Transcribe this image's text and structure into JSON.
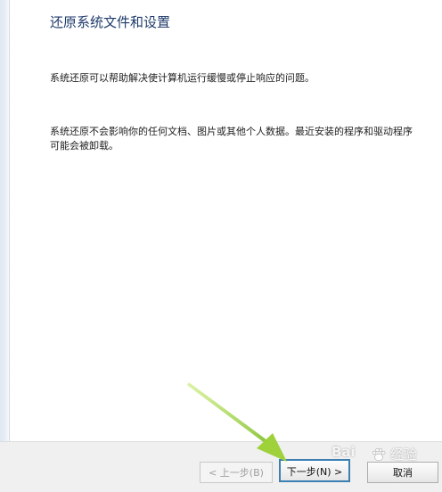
{
  "page": {
    "title": "还原系统文件和设置",
    "paragraph_1": "系统还原可以帮助解决使计算机运行缓慢或停止响应的问题。",
    "paragraph_2": "系统还原不会影响你的任何文档、图片或其他个人数据。最近安装的程序和驱动程序可能会被卸载。"
  },
  "footer": {
    "back_label": "< 上一步(B)",
    "next_label": "下一步(N) >",
    "cancel_label": "取消"
  },
  "annotation": {
    "arrow_color": "#9ed13a"
  },
  "watermark": {
    "logo_text": "Bai",
    "site_text": "经验"
  }
}
